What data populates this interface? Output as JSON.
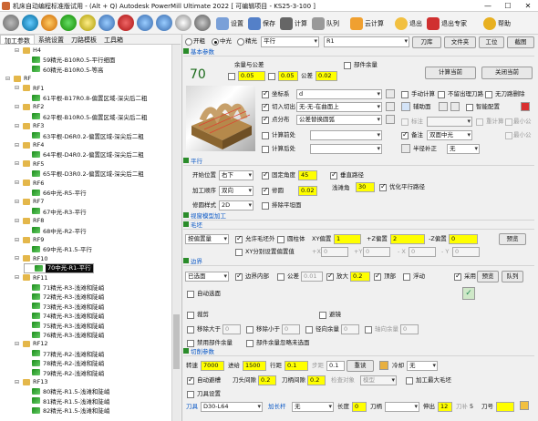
{
  "window": {
    "title": "机床自动编程标准版试用 - (Alt + Q) Autodesk PowerMill Ultimate 2022 [ 可编辑项目 - KS25-3-100 ]",
    "controls": [
      "—",
      "☐",
      "✕"
    ]
  },
  "toolbar": {
    "buttons": [
      "设置",
      "保存",
      "计算",
      "队列",
      "云计算",
      "退出",
      "退出专家",
      "帮助"
    ]
  },
  "left_tabs": [
    "加工参数",
    "系统设置",
    "刀路模板",
    "工具箱"
  ],
  "tree": [
    {
      "label": "H4",
      "level": 1,
      "kind": "folder"
    },
    {
      "label": "59精光-B10R0.5-平行细面",
      "level": 2,
      "kind": "path"
    },
    {
      "label": "60精光-B10R0.5-等高",
      "level": 2,
      "kind": "path"
    },
    {
      "label": "RF",
      "level": 0,
      "kind": "folder"
    },
    {
      "label": "RF1",
      "level": 1,
      "kind": "folder"
    },
    {
      "label": "61平根-B17R0.8-偏置区域-深尖后二粗",
      "level": 2,
      "kind": "path"
    },
    {
      "label": "RF2",
      "level": 1,
      "kind": "folder"
    },
    {
      "label": "62平根-B10R0.5-偏置区域-深尖后二粗",
      "level": 2,
      "kind": "path"
    },
    {
      "label": "RF3",
      "level": 1,
      "kind": "folder"
    },
    {
      "label": "63平根-D6R0.2-偏置区域-深尖后二粗",
      "level": 2,
      "kind": "path"
    },
    {
      "label": "RF4",
      "level": 1,
      "kind": "folder"
    },
    {
      "label": "64平根-D4R0.2-偏置区域-深尖后二粗",
      "level": 2,
      "kind": "path"
    },
    {
      "label": "RF5",
      "level": 1,
      "kind": "folder"
    },
    {
      "label": "65平根-D3R0.2-偏置区域-深尖后二粗",
      "level": 2,
      "kind": "path"
    },
    {
      "label": "RF6",
      "level": 1,
      "kind": "folder"
    },
    {
      "label": "66中光-R5-平行",
      "level": 2,
      "kind": "path"
    },
    {
      "label": "RF7",
      "level": 1,
      "kind": "folder"
    },
    {
      "label": "67中光-R3-平行",
      "level": 2,
      "kind": "path"
    },
    {
      "label": "RF8",
      "level": 1,
      "kind": "folder"
    },
    {
      "label": "68中光-R2-平行",
      "level": 2,
      "kind": "path"
    },
    {
      "label": "RF9",
      "level": 1,
      "kind": "folder"
    },
    {
      "label": "69中光-R1.5-平行",
      "level": 2,
      "kind": "path"
    },
    {
      "label": "RF10",
      "level": 1,
      "kind": "folder"
    },
    {
      "label": "70中光-R1-平行",
      "level": 2,
      "kind": "path",
      "selected": true
    },
    {
      "label": "RF11",
      "level": 1,
      "kind": "folder"
    },
    {
      "label": "71精光-R3-浅滩和陡峭",
      "level": 2,
      "kind": "path"
    },
    {
      "label": "72精光-R3-浅滩和陡峭",
      "level": 2,
      "kind": "path"
    },
    {
      "label": "73精光-R3-浅滩和陡峭",
      "level": 2,
      "kind": "path"
    },
    {
      "label": "74精光-R3-浅滩和陡峭",
      "level": 2,
      "kind": "path"
    },
    {
      "label": "75精光-R3-浅滩和陡峭",
      "level": 2,
      "kind": "path"
    },
    {
      "label": "76精光-R3-浅滩和陡峭",
      "level": 2,
      "kind": "path"
    },
    {
      "label": "RF12",
      "level": 1,
      "kind": "folder"
    },
    {
      "label": "77精光-R2-浅滩和陡峭",
      "level": 2,
      "kind": "path"
    },
    {
      "label": "78精光-R2-浅滩和陡峭",
      "level": 2,
      "kind": "path"
    },
    {
      "label": "79精光-R2-浅滩和陡峭",
      "level": 2,
      "kind": "path"
    },
    {
      "label": "RF13",
      "level": 1,
      "kind": "folder"
    },
    {
      "label": "80精光-R1.5-浅滩和陡峭",
      "level": 2,
      "kind": "path"
    },
    {
      "label": "81精光-R1.5-浅滩和陡峭",
      "level": 2,
      "kind": "path"
    },
    {
      "label": "82精光-R1.5-浅滩和陡峭",
      "level": 2,
      "kind": "path"
    }
  ],
  "top": {
    "opts": [
      "开粗",
      "中光",
      "精光"
    ],
    "strategy": "平行",
    "tool_name": "R1",
    "tool_btn": "刀库",
    "file_btn": "文件夹",
    "work_btn": "工位",
    "scr_btn": "截图"
  },
  "basic": {
    "section": "基本参数",
    "op_no": "70",
    "allowance_title": "余量与公差",
    "allow1": "0.05",
    "allow2": "0.05",
    "tol_label": "公差",
    "tol": "0.02",
    "part_allow": "部件余量",
    "calc_now": "计算当前",
    "close_calc": "关闭当前",
    "coord_label": "坐标系",
    "coord": "d",
    "cut_label": "切入切出",
    "cut": "无-无-在曲面上",
    "pt_label": "点分布",
    "pt": "公差替换圆弧",
    "calc_before": "计算前处",
    "calc_after": "计算后处",
    "manual": "手动计算",
    "no_empty": "不留出理刀路",
    "del_empty": "无刀路删除",
    "smart": "智能配置",
    "filter": "标注",
    "note_label": "备注",
    "note": "双面中光",
    "half": "半径补正",
    "half_val": "无",
    "assist": "辅助面",
    "repeat1": "重计算",
    "repeat2": "最小公",
    "repeat3": "最小公"
  },
  "parallel": {
    "section": "平行",
    "start_label": "开始位置",
    "start": "右下",
    "order_label": "加工顺序",
    "order": "双向",
    "style_label": "修圆样式",
    "style": "2D",
    "fix_angle": "固定角度",
    "fix_angle_val": "45",
    "repair": "修圆",
    "repair_val": "0.02",
    "cut_flat": "排除平坦面",
    "vert": "垂直路径",
    "flat_label": "浅滩角",
    "flat_val": "30",
    "opt": "优化平行路径"
  },
  "limit": {
    "section": "视窗模型加工",
    "blank_section": "毛坯",
    "blank_type": "按偏置量",
    "allow_out": "允许毛坯外",
    "cylinder": "圆柱体",
    "xy_off_label": "XY偏置",
    "xy_off": "1",
    "z_pos_label": "+Z偏置",
    "z_pos": "2",
    "z_neg_label": "-Z偏置",
    "z_neg": "0",
    "preview": "预览",
    "xy_sep": "XY分别设置偏置值",
    "x_off": "0",
    "y_off": "0",
    "x2": "0",
    "y2": "0"
  },
  "bound": {
    "section": "边界",
    "type": "已选面",
    "inside": "边界内部",
    "tol": "公差",
    "tol_val": "0.01",
    "enlarge": "放大",
    "enlarge_val": "0.2",
    "top": "顶部",
    "float": "浮动",
    "adopt": "采用",
    "preview": "预览",
    "queue": "队列",
    "auto": "自动选面",
    "cut_face": "裁剪",
    "avoid": "避镜",
    "move_big": "移除大于",
    "move_big_val": "0",
    "move_small": "移除小于",
    "move_small_val": "0",
    "path_range": "径向余量",
    "path_val": "0",
    "axial": "轴向余量",
    "axial_val": "0",
    "del_parts": "禁用部件余量",
    "del_parts2": "部件余量忽略未选面"
  },
  "cutting": {
    "section": "切削参数",
    "speed_label": "转速",
    "speed": "7000",
    "feed_label": "进给",
    "feed": "1500",
    "step_label": "行距",
    "step": "0.1",
    "depth_label": "步距",
    "depth": "0.1",
    "calc": "重读",
    "cool_label": "冷却",
    "cool": "无",
    "auto_avoid": "自动避槽",
    "tool_len": "刀头间隙",
    "tool_len_val": "0.2",
    "holder": "刀柄间隙",
    "holder_val": "0.2",
    "check_type": "检查对象",
    "check_val": "模型",
    "max_depth": "加工最大毛坯",
    "tool_data": "刀具设置",
    "tool_lbl": "刀具",
    "tool": "D30-L64",
    "holder_lbl": "加长杆",
    "holder_sel": "无",
    "len_lbl": "长度",
    "len": "0",
    "shank_lbl": "刀柄",
    "out_lbl": "伸出",
    "out": "12",
    "no_lbl": "刀号",
    "no": "5"
  },
  "colors": {
    "yellow": "#ffff00",
    "green": "#2a8c2a",
    "blue": "#0a58c6"
  }
}
